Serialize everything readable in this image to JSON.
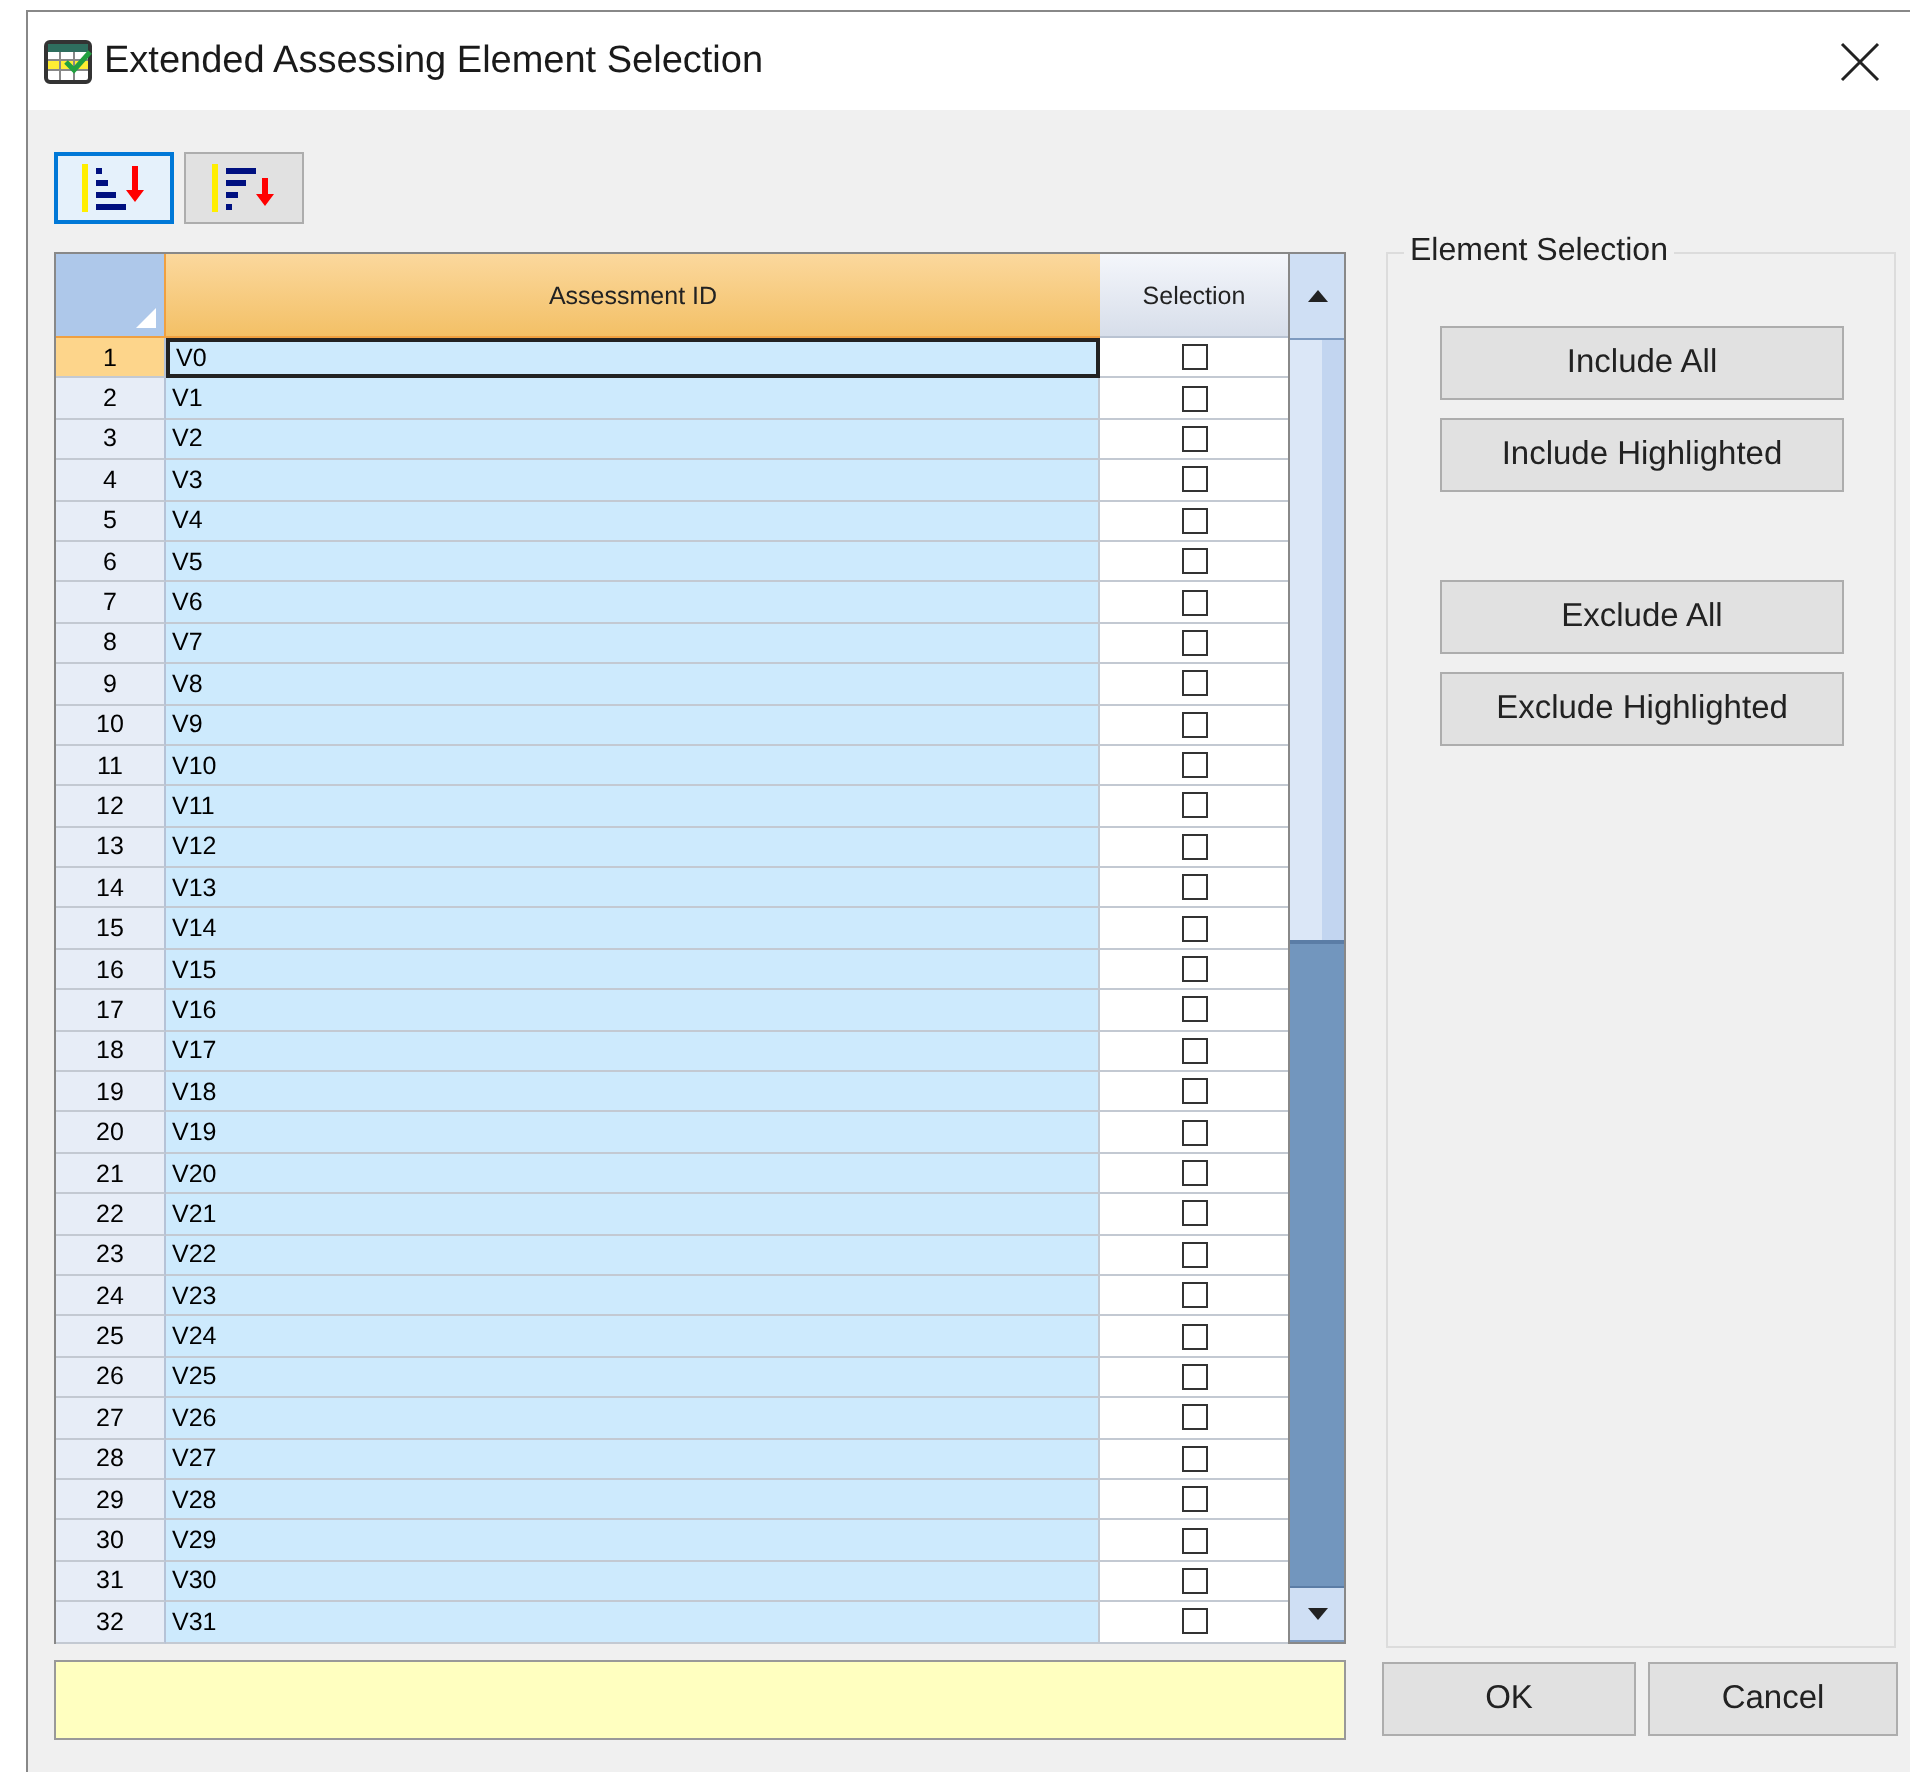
{
  "window": {
    "title": "Extended Assessing Element Selection"
  },
  "toolbar": [
    {
      "kind": "sort-ascending",
      "selected": true
    },
    {
      "kind": "sort-descending",
      "selected": false
    }
  ],
  "table": {
    "columns": [
      "Assessment ID",
      "Selection"
    ],
    "rows": [
      {
        "number": "1",
        "id": "V0",
        "checked": false,
        "selected": true
      },
      {
        "number": "2",
        "id": "V1",
        "checked": false,
        "selected": false
      },
      {
        "number": "3",
        "id": "V2",
        "checked": false,
        "selected": false
      },
      {
        "number": "4",
        "id": "V3",
        "checked": false,
        "selected": false
      },
      {
        "number": "5",
        "id": "V4",
        "checked": false,
        "selected": false
      },
      {
        "number": "6",
        "id": "V5",
        "checked": false,
        "selected": false
      },
      {
        "number": "7",
        "id": "V6",
        "checked": false,
        "selected": false
      },
      {
        "number": "8",
        "id": "V7",
        "checked": false,
        "selected": false
      },
      {
        "number": "9",
        "id": "V8",
        "checked": false,
        "selected": false
      },
      {
        "number": "10",
        "id": "V9",
        "checked": false,
        "selected": false
      },
      {
        "number": "11",
        "id": "V10",
        "checked": false,
        "selected": false
      },
      {
        "number": "12",
        "id": "V11",
        "checked": false,
        "selected": false
      },
      {
        "number": "13",
        "id": "V12",
        "checked": false,
        "selected": false
      },
      {
        "number": "14",
        "id": "V13",
        "checked": false,
        "selected": false
      },
      {
        "number": "15",
        "id": "V14",
        "checked": false,
        "selected": false
      },
      {
        "number": "16",
        "id": "V15",
        "checked": false,
        "selected": false
      },
      {
        "number": "17",
        "id": "V16",
        "checked": false,
        "selected": false
      },
      {
        "number": "18",
        "id": "V17",
        "checked": false,
        "selected": false
      },
      {
        "number": "19",
        "id": "V18",
        "checked": false,
        "selected": false
      },
      {
        "number": "20",
        "id": "V19",
        "checked": false,
        "selected": false
      },
      {
        "number": "21",
        "id": "V20",
        "checked": false,
        "selected": false
      },
      {
        "number": "22",
        "id": "V21",
        "checked": false,
        "selected": false
      },
      {
        "number": "23",
        "id": "V22",
        "checked": false,
        "selected": false
      },
      {
        "number": "24",
        "id": "V23",
        "checked": false,
        "selected": false
      },
      {
        "number": "25",
        "id": "V24",
        "checked": false,
        "selected": false
      },
      {
        "number": "26",
        "id": "V25",
        "checked": false,
        "selected": false
      },
      {
        "number": "27",
        "id": "V26",
        "checked": false,
        "selected": false
      },
      {
        "number": "28",
        "id": "V27",
        "checked": false,
        "selected": false
      },
      {
        "number": "29",
        "id": "V28",
        "checked": false,
        "selected": false
      },
      {
        "number": "30",
        "id": "V29",
        "checked": false,
        "selected": false
      },
      {
        "number": "31",
        "id": "V30",
        "checked": false,
        "selected": false
      },
      {
        "number": "32",
        "id": "V31",
        "checked": false,
        "selected": false
      }
    ]
  },
  "element_selection": {
    "title": "Element Selection",
    "buttons": [
      "Include All",
      "Include Highlighted",
      "Exclude All",
      "Exclude Highlighted"
    ]
  },
  "dialog_buttons": [
    "OK",
    "Cancel"
  ]
}
